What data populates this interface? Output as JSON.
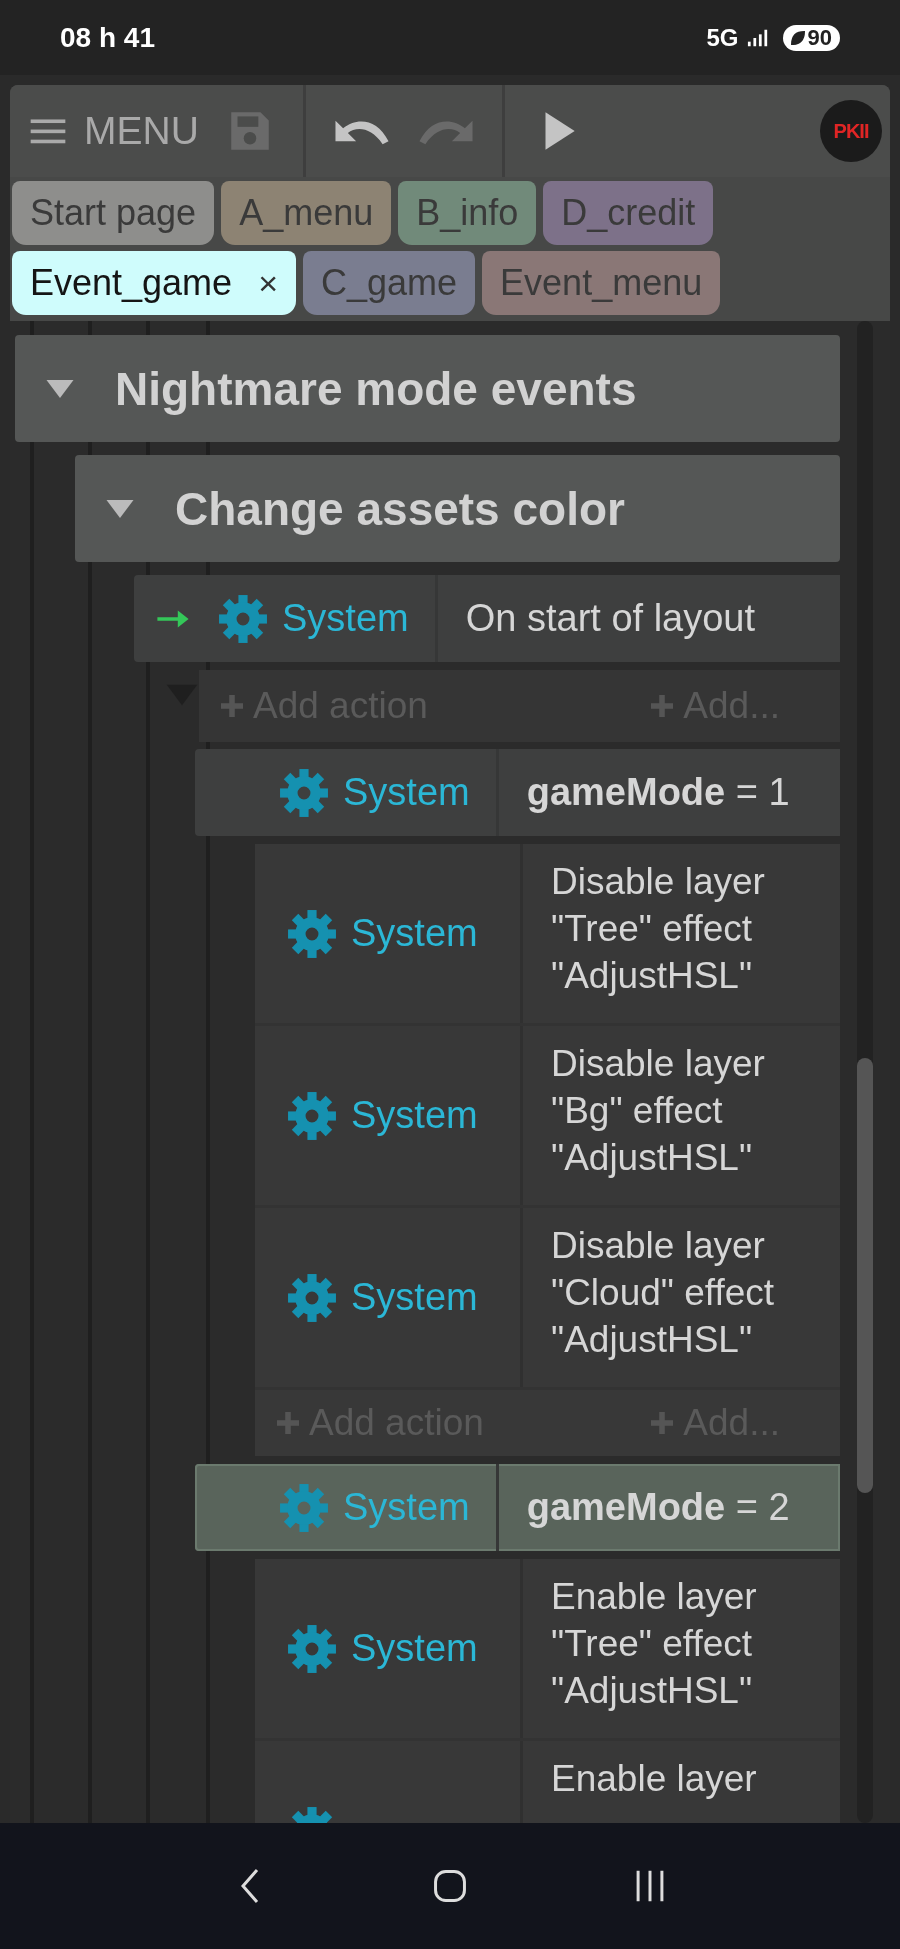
{
  "status_bar": {
    "time": "08 h 41",
    "network": "5G",
    "battery": "90"
  },
  "toolbar": {
    "menu_label": "MENU",
    "logo": "PKII",
    "buttons": [
      {
        "kind": "save",
        "disabled": true
      },
      {
        "kind": "undo",
        "disabled": false
      },
      {
        "kind": "redo",
        "disabled": true
      },
      {
        "kind": "play",
        "disabled": false
      }
    ]
  },
  "tabs": [
    {
      "label": "Start page",
      "color": "#8e8e8c",
      "selected": false
    },
    {
      "label": "A_menu",
      "color": "#8d8373",
      "selected": false
    },
    {
      "label": "B_info",
      "color": "#718a7a",
      "selected": false
    },
    {
      "label": "D_credit",
      "color": "#7d7189",
      "selected": false
    },
    {
      "label": "Event_game",
      "color": "#cffcfc",
      "selected": true,
      "close": "×"
    },
    {
      "label": "C_game",
      "color": "#7a7d90",
      "selected": false
    },
    {
      "label": "Event_menu",
      "color": "#8a7776",
      "selected": false
    }
  ],
  "sheet": {
    "groups": [
      {
        "title": "Nightmare mode events",
        "expanded": true,
        "groups": [
          {
            "title": "Change assets color",
            "expanded": true,
            "events": [
              {
                "expanded": true,
                "conditions": [
                  {
                    "object": "System",
                    "text": "On start of layout",
                    "trigger": true
                  }
                ],
                "add_action": "Add action",
                "add_other": "Add...",
                "subevents": [
                  {
                    "selected": false,
                    "conditions": [
                      {
                        "object": "System",
                        "text": "**gameMode** = 1",
                        "trigger": false
                      }
                    ],
                    "actions": [
                      {
                        "object": "System",
                        "text": "Disable layer \"Tree\" effect \"AdjustHSL\""
                      },
                      {
                        "object": "System",
                        "text": "Disable layer \"Bg\" effect \"AdjustHSL\""
                      },
                      {
                        "object": "System",
                        "text": "Disable layer \"Cloud\" effect \"AdjustHSL\""
                      }
                    ],
                    "add_action": "Add action",
                    "add_other": "Add..."
                  },
                  {
                    "selected": true,
                    "conditions": [
                      {
                        "object": "System",
                        "text": "**gameMode** = 2",
                        "trigger": false
                      }
                    ],
                    "actions": [
                      {
                        "object": "System",
                        "text": "Enable layer \"Tree\" effect \"AdjustHSL\""
                      },
                      {
                        "text": "Enable layer"
                      }
                    ]
                  }
                ]
              }
            ]
          }
        ]
      }
    ]
  }
}
